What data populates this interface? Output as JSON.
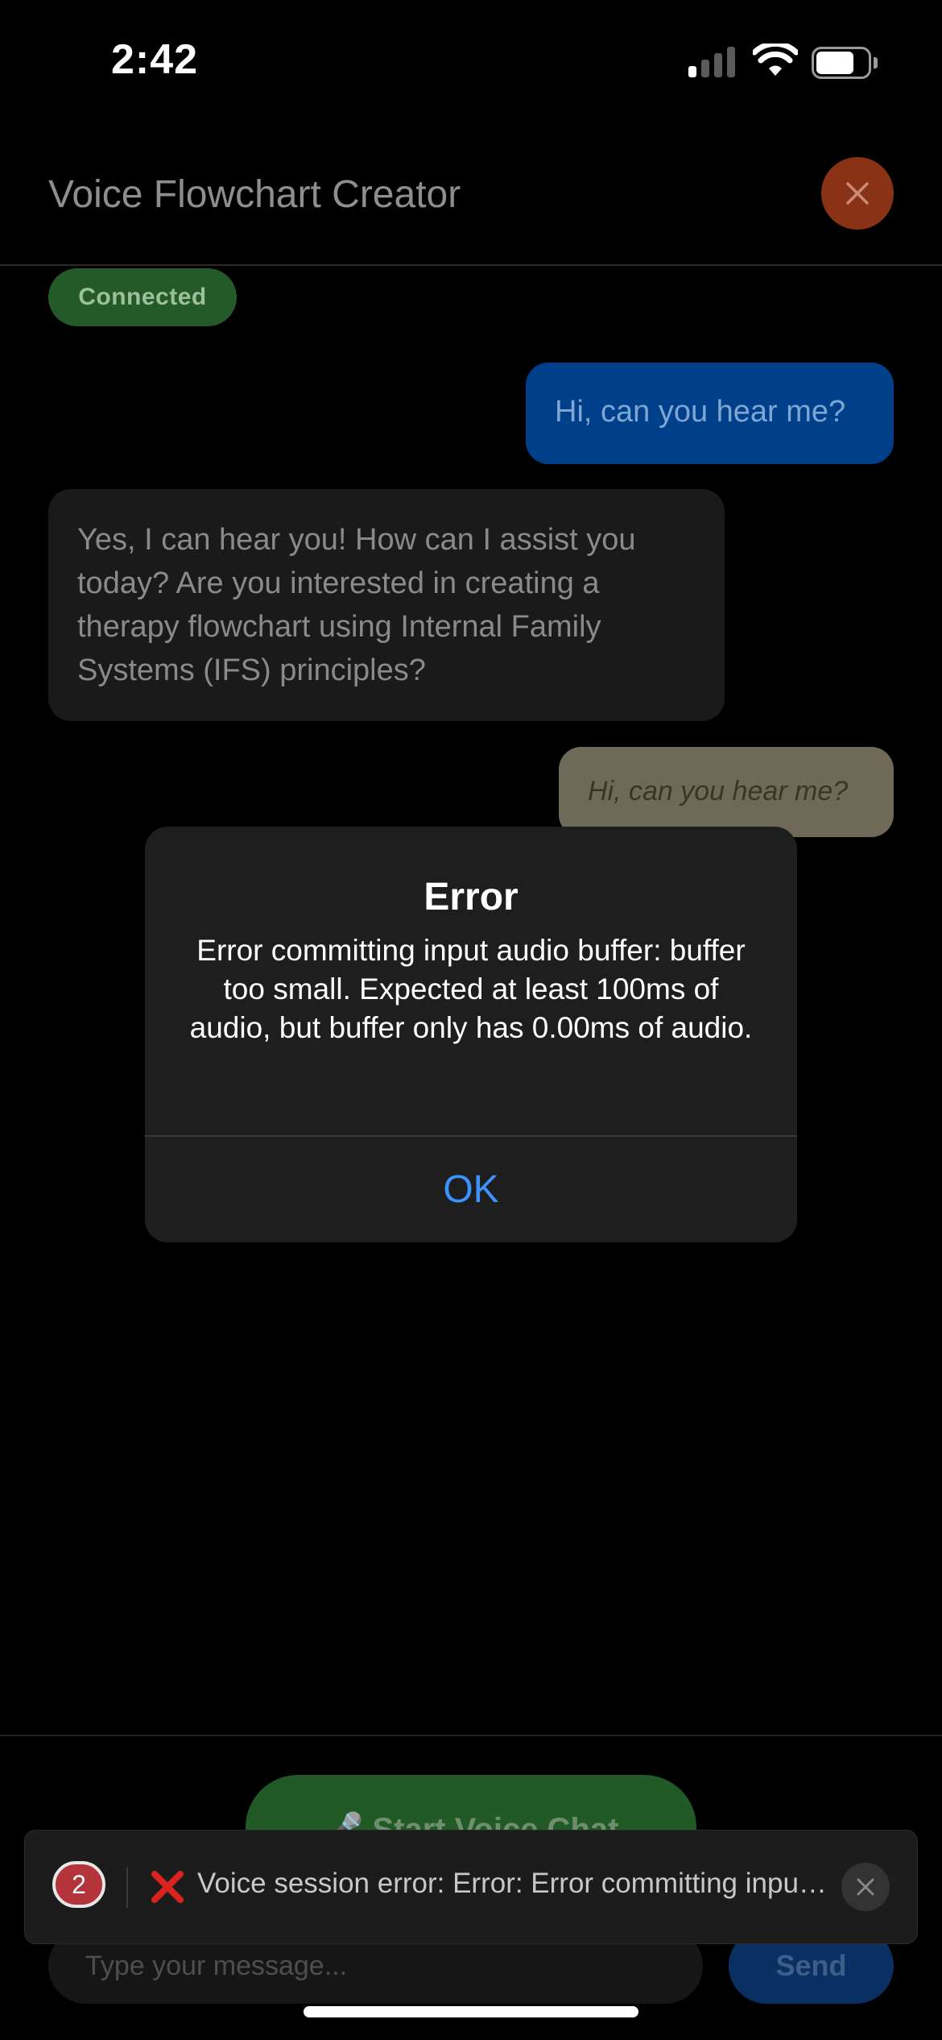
{
  "status_bar": {
    "time": "2:42",
    "signal_bars_active": 1,
    "signal_bars_total": 4
  },
  "header": {
    "title": "Voice Flowchart Creator",
    "close_icon": "close-icon"
  },
  "connection": {
    "status": "Connected",
    "color": "#235a27"
  },
  "messages": [
    {
      "role": "user",
      "text": "Hi, can you hear me?"
    },
    {
      "role": "assistant",
      "text": "Yes, I can hear you! How can I assist you today? Are you interested in creating a therapy flowchart using Internal Family Systems (IFS) principles?"
    },
    {
      "role": "user-transcript",
      "text": "Hi, can you hear me?"
    }
  ],
  "alert": {
    "title": "Error",
    "message": "Error committing input audio buffer: buffer too small. Expected at least 100ms of audio, but buffer only has 0.00ms of audio.",
    "ok_label": "OK"
  },
  "voice_button": {
    "label": "🎤 Start Voice Chat"
  },
  "composer": {
    "placeholder": "Type your message...",
    "send_label": "Send"
  },
  "toast": {
    "count": "2",
    "text": "Voice session error: Error: Error committing input audio buffer: buffer too small. Expected at least 100ms of audio, but buffer only has 0.00ms of audio.",
    "icon": "cross-mark-icon"
  },
  "colors": {
    "accent_blue": "#3b93ff",
    "user_bubble": "#003f8a",
    "close_button": "#8a3216",
    "error_badge": "#b3353b"
  }
}
